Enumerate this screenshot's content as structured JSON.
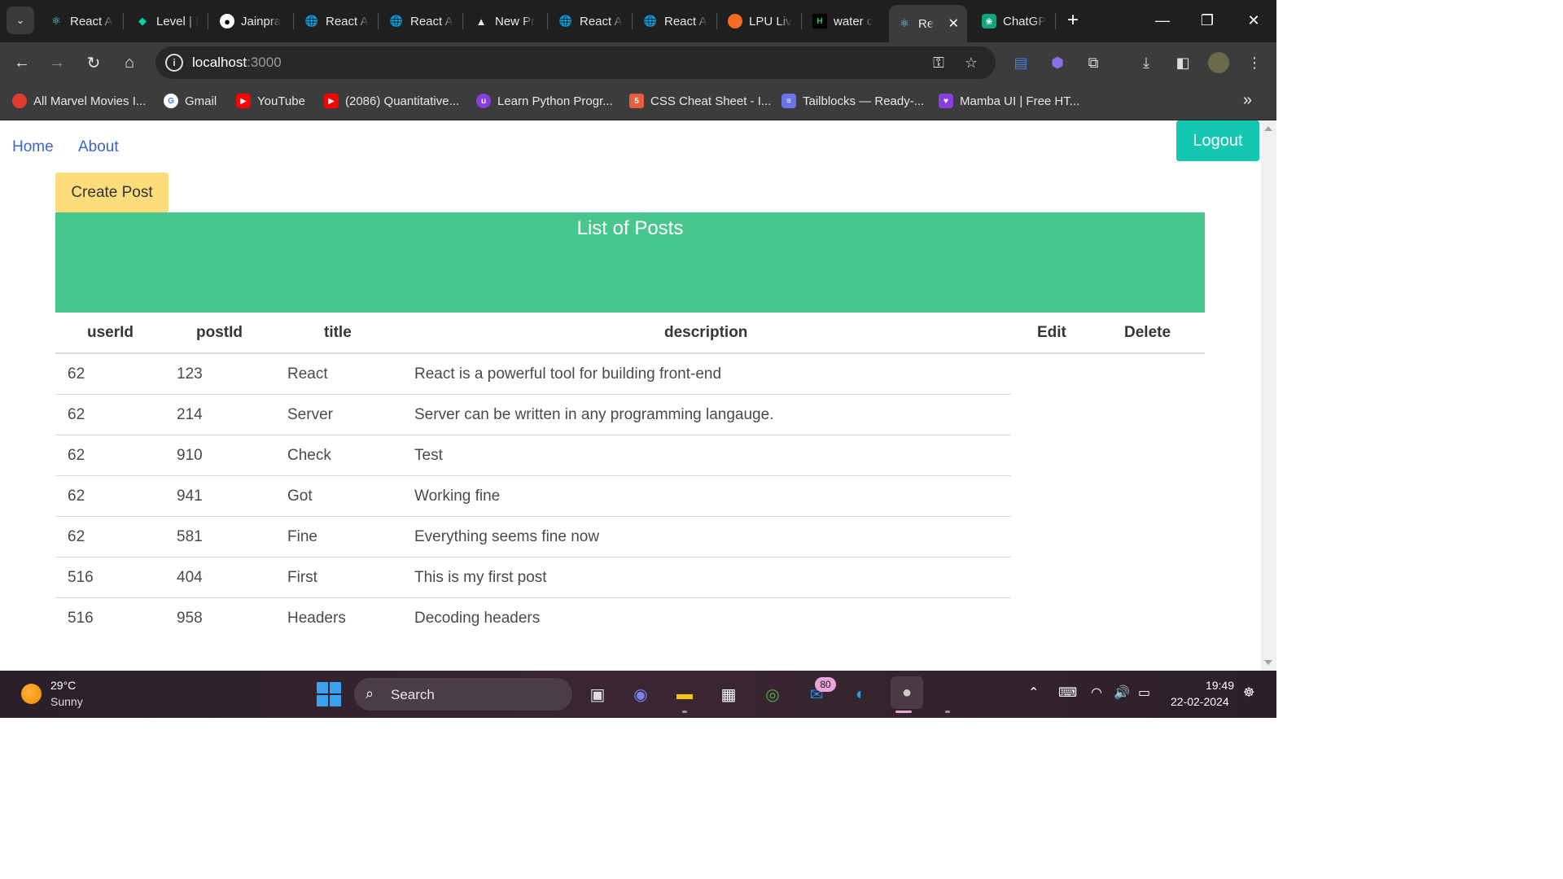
{
  "browser": {
    "tabs": [
      {
        "title": "React A",
        "favicon": "react-icon"
      },
      {
        "title": "Level | I",
        "favicon": "leetcode-icon"
      },
      {
        "title": "Jainpra",
        "favicon": "github-icon"
      },
      {
        "title": "React A",
        "favicon": "globe-icon"
      },
      {
        "title": "React A",
        "favicon": "globe-icon"
      },
      {
        "title": "New Pr",
        "favicon": "vercel-icon"
      },
      {
        "title": "React A",
        "favicon": "globe-icon"
      },
      {
        "title": "React A",
        "favicon": "globe-icon"
      },
      {
        "title": "LPU Liv",
        "favicon": "lpu-icon"
      },
      {
        "title": "water c",
        "favicon": "hackerrank-icon"
      },
      {
        "title": "Re",
        "favicon": "react-icon"
      },
      {
        "title": "ChatGP",
        "favicon": "chatgpt-icon"
      }
    ],
    "url_host": "localhost",
    "url_port": ":3000",
    "bookmarks": [
      {
        "label": "All Marvel Movies I...",
        "color": "#e23b2e"
      },
      {
        "label": "Gmail",
        "color": "#ffffff"
      },
      {
        "label": "YouTube",
        "color": "#ff0000"
      },
      {
        "label": "(2086) Quantitative...",
        "color": "#ff0000"
      },
      {
        "label": "Learn Python Progr...",
        "color": "#8a3ee0"
      },
      {
        "label": "CSS Cheat Sheet - I...",
        "color": "#e85d3a"
      },
      {
        "label": "Tailblocks — Ready-...",
        "color": "#6b74e8"
      },
      {
        "label": "Mamba UI | Free HT...",
        "color": "#8a3ee0"
      }
    ]
  },
  "page": {
    "nav": {
      "home": "Home",
      "about": "About"
    },
    "logout_label": "Logout",
    "create_post_label": "Create Post",
    "list_title": "List of Posts",
    "columns": [
      "userId",
      "postId",
      "title",
      "description",
      "Edit",
      "Delete"
    ],
    "rows": [
      {
        "userId": "62",
        "postId": "123",
        "title": "React",
        "description": "React is a powerful tool for building front-end"
      },
      {
        "userId": "62",
        "postId": "214",
        "title": "Server",
        "description": "Server can be written in any programming langauge."
      },
      {
        "userId": "62",
        "postId": "910",
        "title": "Check",
        "description": "Test"
      },
      {
        "userId": "62",
        "postId": "941",
        "title": "Got",
        "description": "Working fine"
      },
      {
        "userId": "62",
        "postId": "581",
        "title": "Fine",
        "description": "Everything seems fine now"
      },
      {
        "userId": "516",
        "postId": "404",
        "title": "First",
        "description": "This is my first post"
      },
      {
        "userId": "516",
        "postId": "958",
        "title": "Headers",
        "description": "Decoding headers"
      }
    ],
    "colors": {
      "logout": "#14c7b0",
      "create_post": "#fddc7c",
      "banner": "#48c78c",
      "link": "#3b67c4"
    }
  },
  "taskbar": {
    "weather_temp": "29°C",
    "weather_condition": "Sunny",
    "search_placeholder": "Search",
    "notification_badge": "80",
    "time": "19:49",
    "date": "22-02-2024"
  }
}
